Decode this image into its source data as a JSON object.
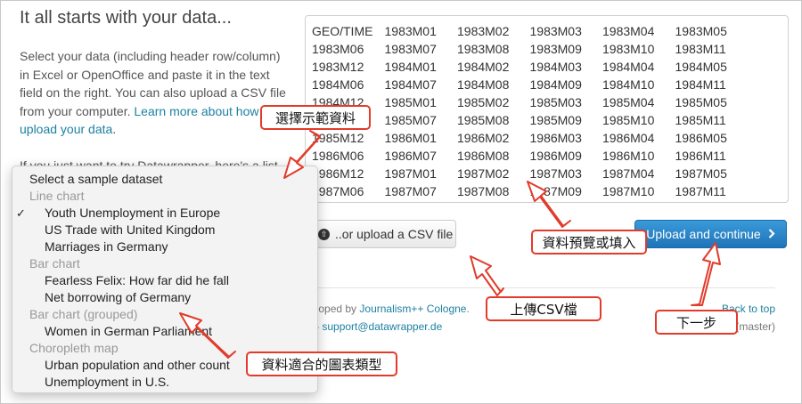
{
  "page": {
    "title": "It all starts with your data...",
    "intro_text": "Select your data (including header row/column) in Excel or OpenOffice and paste it in the text field on the right. You can also upload a CSV file from your computer. ",
    "learn_more_link": "Learn more about how to upload your data",
    "intro_end": ".",
    "try_text": "If you just want to try Datawrapper, here's a list"
  },
  "data_area": {
    "rows": [
      [
        "GEO/TIME",
        "1983M01",
        "1983M02",
        "1983M03",
        "1983M04",
        "1983M05"
      ],
      [
        "1983M06",
        "1983M07",
        "1983M08",
        "1983M09",
        "1983M10",
        "1983M11"
      ],
      [
        "1983M12",
        "1984M01",
        "1984M02",
        "1984M03",
        "1984M04",
        "1984M05"
      ],
      [
        "1984M06",
        "1984M07",
        "1984M08",
        "1984M09",
        "1984M10",
        "1984M11"
      ],
      [
        "1984M12",
        "1985M01",
        "1985M02",
        "1985M03",
        "1985M04",
        "1985M05"
      ],
      [
        "1985M06",
        "1985M07",
        "1985M08",
        "1985M09",
        "1985M10",
        "1985M11"
      ],
      [
        "1985M12",
        "1986M01",
        "1986M02",
        "1986M03",
        "1986M04",
        "1986M05"
      ],
      [
        "1986M06",
        "1986M07",
        "1986M08",
        "1986M09",
        "1986M10",
        "1986M11"
      ],
      [
        "1986M12",
        "1987M01",
        "1987M02",
        "1987M03",
        "1987M04",
        "1987M05"
      ],
      [
        "1987M06",
        "1987M07",
        "1987M08",
        "1987M09",
        "1987M10",
        "1987M11"
      ]
    ]
  },
  "buttons": {
    "upload_label": "..or upload a CSV file",
    "continue_label": "Upload and continue",
    "continue_icon": "chevron-right-icon",
    "upload_icon": "upload-circle-icon"
  },
  "footer": {
    "left_prefix": "veloped by ",
    "left_link": "Journalism++ Cologne",
    "left_suffix": ".",
    "left_line2_prefix": "y – ",
    "left_line2_link": "support@datawrapper.de",
    "right_link": "Back to top",
    "right_line2": "(master)"
  },
  "dropdown": {
    "items": [
      {
        "type": "title",
        "label": "Select a sample dataset"
      },
      {
        "type": "group",
        "label": "Line chart"
      },
      {
        "type": "option",
        "label": "Youth Unemployment in Europe",
        "checked": true
      },
      {
        "type": "option",
        "label": "US Trade with United Kingdom"
      },
      {
        "type": "option",
        "label": "Marriages in Germany"
      },
      {
        "type": "group",
        "label": "Bar chart"
      },
      {
        "type": "option",
        "label": "Fearless Felix: How far did he fall"
      },
      {
        "type": "option",
        "label": "Net borrowing of Germany"
      },
      {
        "type": "group",
        "label": "Bar chart (grouped)"
      },
      {
        "type": "option",
        "label": "Women in German Parliament"
      },
      {
        "type": "group",
        "label": "Choropleth map"
      },
      {
        "type": "option",
        "label": "Urban population and other count"
      },
      {
        "type": "option",
        "label": "Unemployment in U.S."
      }
    ],
    "check_glyph": "✓"
  },
  "annotations": {
    "sample_data": "選擇示範資料",
    "preview": "資料預覽或填入",
    "upload_csv": "上傳CSV檔",
    "next_step": "下一步",
    "chart_types": "資料適合的圖表類型"
  },
  "colors": {
    "link": "#1d81a2",
    "primary_button": "#2a86c8",
    "annotation_border": "#e23b2b"
  }
}
